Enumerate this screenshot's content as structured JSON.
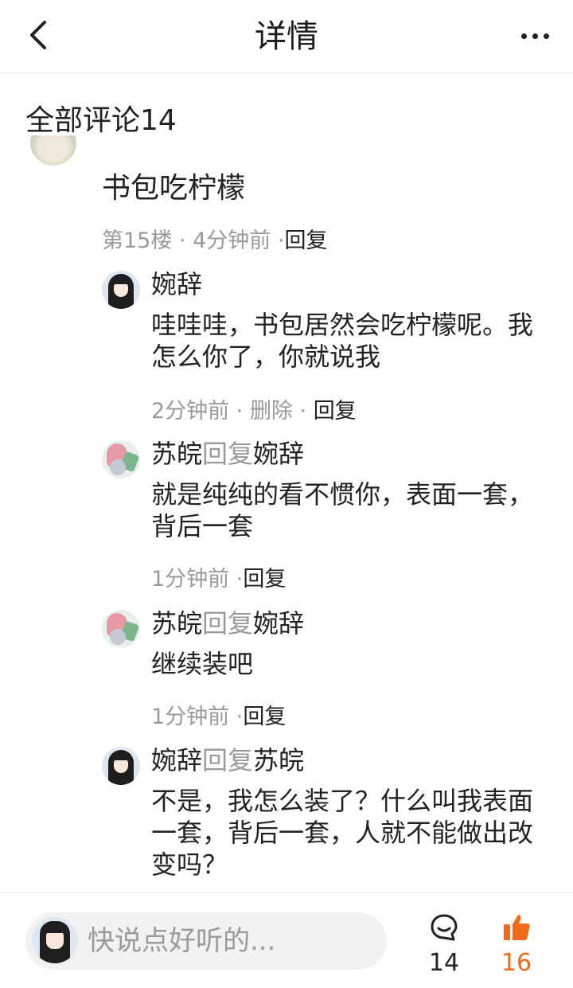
{
  "header": {
    "title": "详情"
  },
  "comments_section": {
    "title": "全部评论14"
  },
  "main_comment": {
    "author": "书包吃柠檬",
    "floor": "第15楼",
    "sep1": " · ",
    "time": "4分钟前",
    "sep2": " ·",
    "reply_label": "回复"
  },
  "replies": [
    {
      "author": "婉辞",
      "verb": "",
      "target": "",
      "text": "哇哇哇，书包居然会吃柠檬呢。我怎么你了，你就说我",
      "time": "2分钟前",
      "sep_a": " · ",
      "delete_label": "删除",
      "sep_b": " · ",
      "reply_label": "回复"
    },
    {
      "author": "苏皖",
      "verb": "回复",
      "target": "婉辞",
      "text": "就是纯纯的看不惯你，表面一套，背后一套",
      "time": "1分钟前",
      "sep_b": " ·",
      "reply_label": "回复"
    },
    {
      "author": "苏皖",
      "verb": "回复",
      "target": "婉辞",
      "text": "继续装吧",
      "time": "1分钟前",
      "sep_b": " ·",
      "reply_label": "回复"
    },
    {
      "author": "婉辞",
      "verb": "回复",
      "target": "苏皖",
      "text": "不是，我怎么装了？什么叫我表面一套，背后一套，人就不能做出改变吗？"
    }
  ],
  "bottom_bar": {
    "input_placeholder": "快说点好听的...",
    "comment_count": "14",
    "like_count": "16"
  },
  "colors": {
    "accent": "#f26a1b",
    "muted": "#9a9a9a",
    "text": "#222222"
  },
  "icons": [
    "back-arrow-icon",
    "more-dots-icon",
    "comment-bubble-icon",
    "thumbs-up-icon"
  ]
}
